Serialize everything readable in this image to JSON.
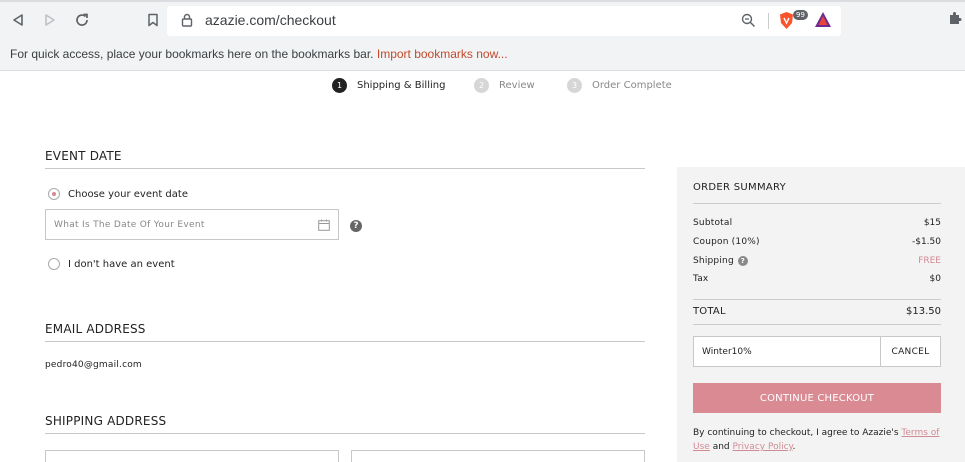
{
  "browser": {
    "url": "azazie.com/checkout",
    "extension_badge": "99"
  },
  "bookmarks_bar": {
    "message": "For quick access, place your bookmarks here on the bookmarks bar.",
    "import_link": "Import bookmarks now..."
  },
  "steps": [
    {
      "num": "1",
      "label": "Shipping & Billing",
      "state": "active"
    },
    {
      "num": "2",
      "label": "Review",
      "state": "inactive"
    },
    {
      "num": "3",
      "label": "Order Complete",
      "state": "inactive"
    }
  ],
  "event_date": {
    "title": "EVENT DATE",
    "option_choose": "Choose your event date",
    "date_placeholder": "What Is The Date Of Your Event",
    "help": "?",
    "option_none": "I don't have an event",
    "selected_option": "choose"
  },
  "email": {
    "title": "EMAIL ADDRESS",
    "value": "pedro40@gmail.com"
  },
  "shipping": {
    "title": "SHIPPING ADDRESS"
  },
  "summary": {
    "title": "ORDER SUMMARY",
    "subtotal_label": "Subtotal",
    "subtotal_value": "$15",
    "coupon_label": "Coupon (10%)",
    "coupon_value": "-$1.50",
    "shipping_label": "Shipping",
    "shipping_help": "?",
    "shipping_value": "FREE",
    "tax_label": "Tax",
    "tax_value": "$0",
    "total_label": "TOTAL",
    "total_value": "$13.50",
    "coupon_code": "Winter10%",
    "cancel_label": "CANCEL",
    "continue_label": "CONTINUE CHECKOUT",
    "terms_prefix": "By continuing to checkout, I agree to Azazie's",
    "terms_link": "Terms of Use",
    "terms_and": "and",
    "privacy_link": "Privacy Policy",
    "terms_suffix": "."
  },
  "colors": {
    "accent": "#d98a93",
    "link_orange": "#c34a2c"
  }
}
